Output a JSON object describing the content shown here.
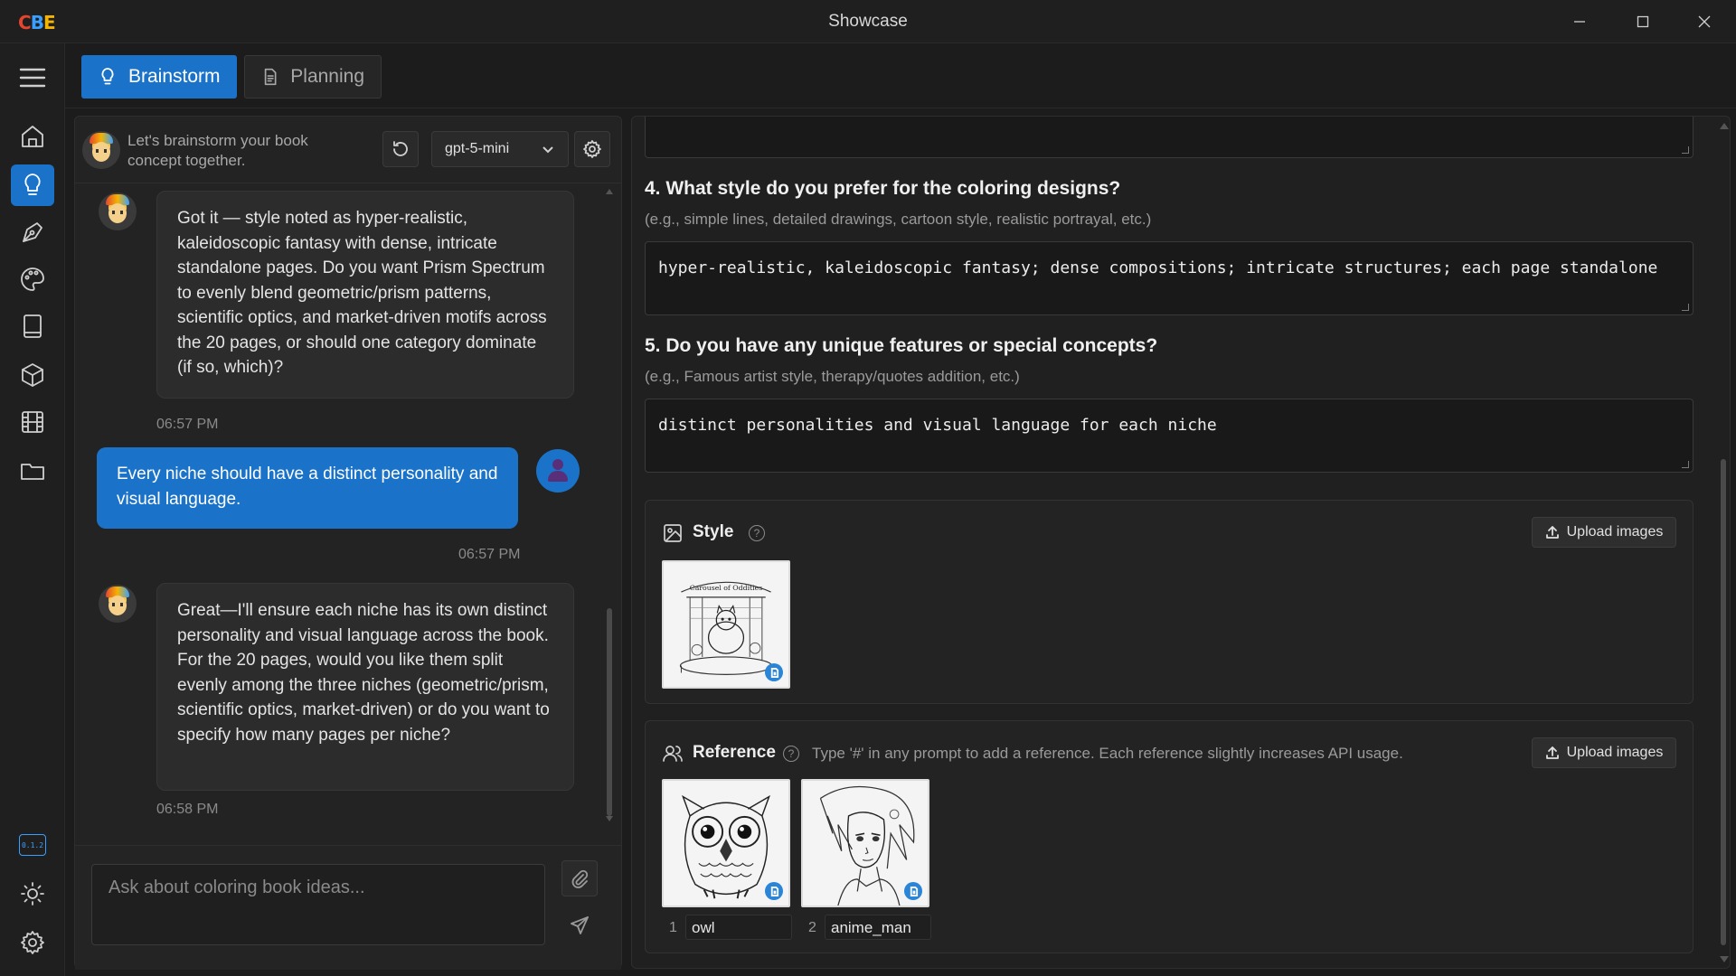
{
  "window": {
    "title": "Showcase",
    "logo_letters": [
      "C",
      "B",
      "E"
    ]
  },
  "tabs": [
    {
      "label": "Brainstorm",
      "active": true
    },
    {
      "label": "Planning",
      "active": false
    }
  ],
  "nav": {
    "items": [
      "home-icon",
      "lightbulb-icon",
      "pen-tool-icon",
      "palette-icon",
      "book-icon",
      "box-icon",
      "film-icon",
      "folder-icon"
    ],
    "active": "lightbulb-icon",
    "bottom": {
      "badge_text": "0.1.2",
      "items": [
        "sun-icon",
        "gear-icon"
      ]
    }
  },
  "chat": {
    "header_text": "Let's brainstorm your book concept together.",
    "model": "gpt-5-mini",
    "messages": [
      {
        "role": "assistant",
        "text": "Got it — style noted as hyper-realistic, kaleidoscopic fantasy with dense, intricate standalone pages. Do you want Prism Spectrum to evenly blend geometric/prism patterns, scientific optics, and market-driven motifs across the 20 pages, or should one category dominate (if so, which)?",
        "time": "06:57 PM"
      },
      {
        "role": "user",
        "text": "Every niche should have a distinct personality and visual language.",
        "time": "06:57 PM"
      },
      {
        "role": "assistant",
        "text": "Great—I'll ensure each niche has its own distinct personality and visual language across the book. For the 20 pages, would you like them split evenly among the three niches (geometric/prism, scientific optics, market-driven) or do you want to specify how many pages per niche?",
        "time": "06:58 PM"
      }
    ],
    "input_placeholder": "Ask about coloring book ideas..."
  },
  "form": {
    "q4": {
      "question": "4. What style do you prefer for the coloring designs?",
      "hint": "(e.g., simple lines, detailed drawings, cartoon style, realistic portrayal, etc.)",
      "answer": "hyper-realistic, kaleidoscopic fantasy; dense compositions; intricate structures; each page standalone"
    },
    "q5": {
      "question": "5. Do you have any unique features or special concepts?",
      "hint": "(e.g., Famous artist style, therapy/quotes addition, etc.)",
      "answer": "distinct personalities and visual language for each niche"
    },
    "style": {
      "title": "Style",
      "help": "?",
      "upload_label": "Upload images",
      "image_caption": "Carousel of Oddities"
    },
    "reference": {
      "title": "Reference",
      "help": "?",
      "hint": "Type '#' in any prompt to add a reference. Each reference slightly increases API usage.",
      "upload_label": "Upload images",
      "items": [
        {
          "index": "1",
          "name": "owl"
        },
        {
          "index": "2",
          "name": "anime_man"
        }
      ]
    }
  },
  "colors": {
    "accent": "#1a73c8",
    "background": "#1c1c1c"
  }
}
